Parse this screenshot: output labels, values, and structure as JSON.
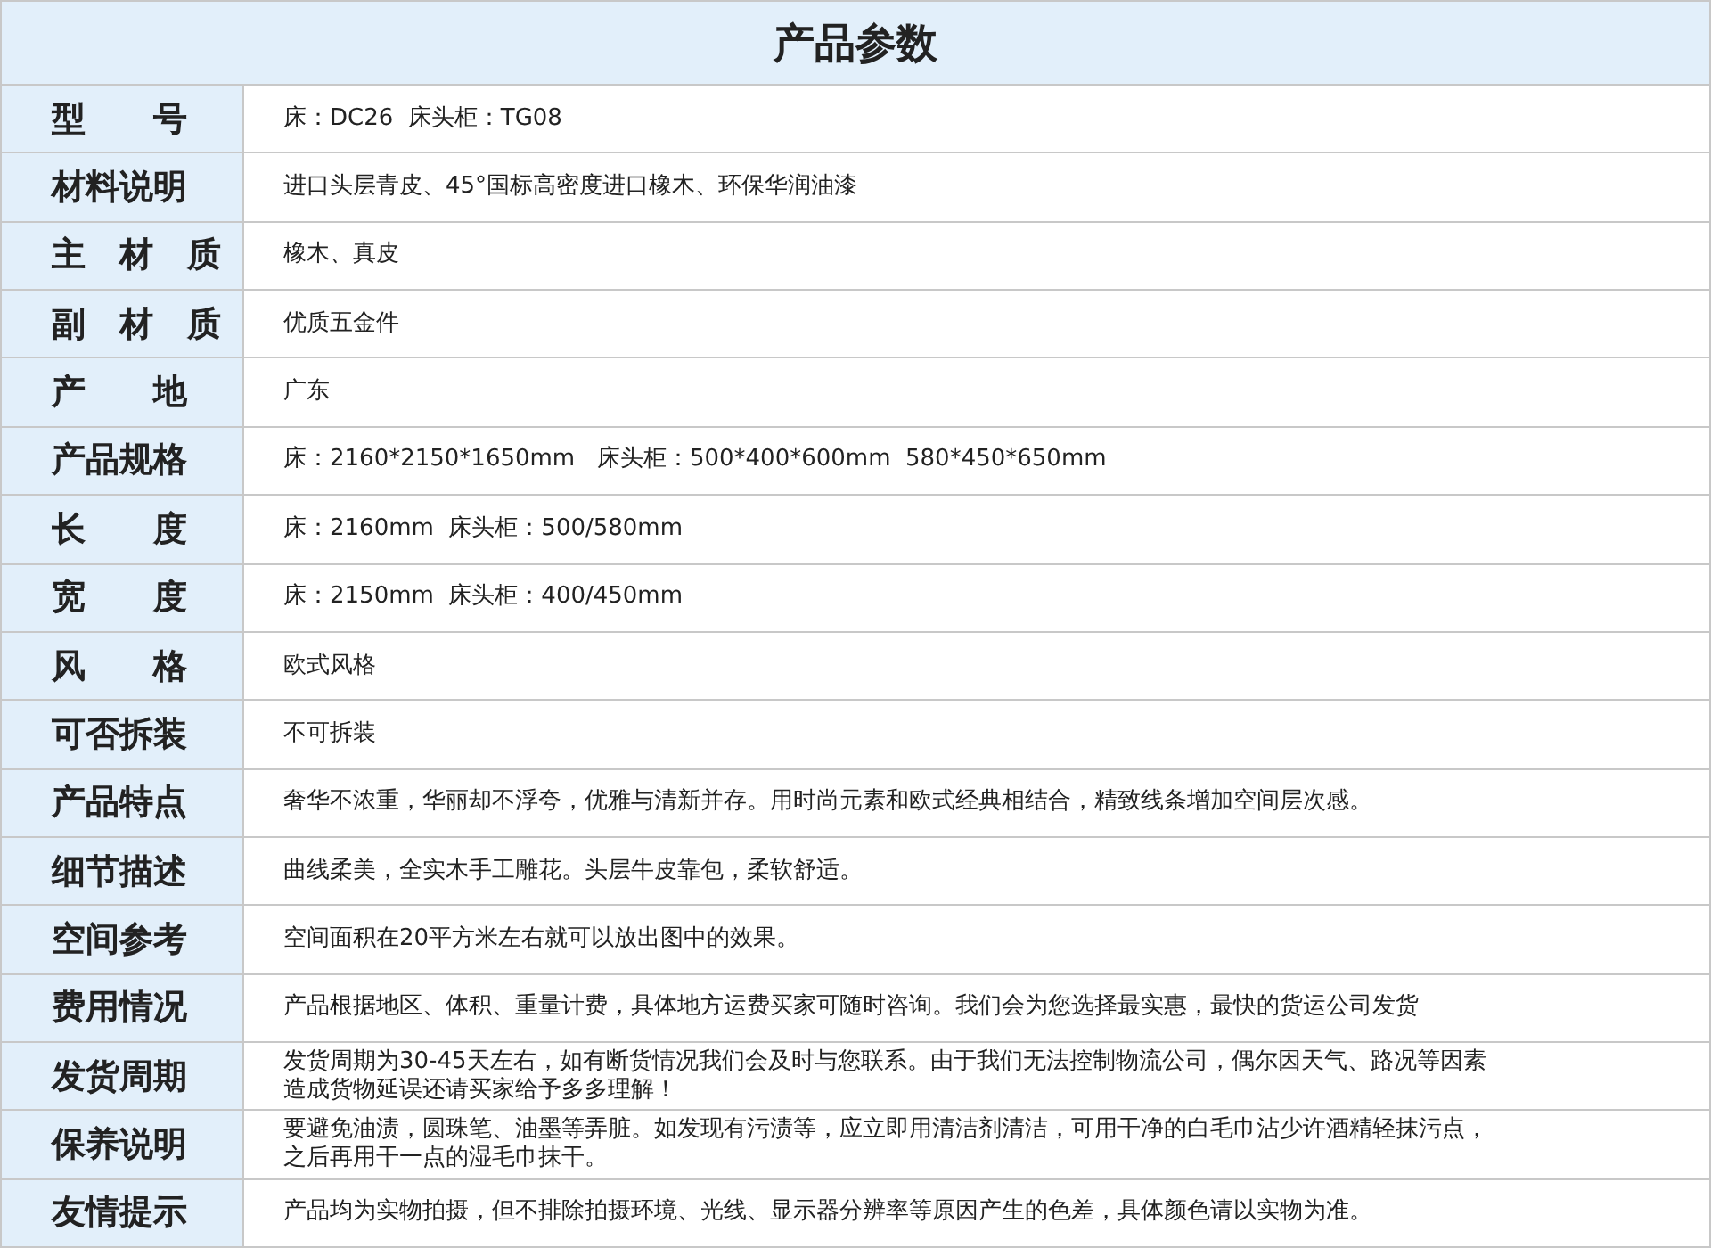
{
  "title": "产品参数",
  "rows": [
    {
      "label": "型　　号",
      "value": [
        "床：DC26  床头柜：TG08"
      ]
    },
    {
      "label": "材料说明",
      "value": [
        "进口头层青皮、45°国标高密度进口橡木、环保华润油漆"
      ]
    },
    {
      "label": "主　材　质",
      "value": [
        "橡木、真皮"
      ]
    },
    {
      "label": "副　材　质",
      "value": [
        "优质五金件"
      ]
    },
    {
      "label": "产　　地",
      "value": [
        "广东"
      ]
    },
    {
      "label": "产品规格",
      "value": [
        "床：2160*2150*1650mm   床头柜：500*400*600mm  580*450*650mm"
      ]
    },
    {
      "label": "长　　度",
      "value": [
        "床：2160mm  床头柜：500/580mm"
      ]
    },
    {
      "label": "宽　　度",
      "value": [
        "床：2150mm  床头柜：400/450mm"
      ]
    },
    {
      "label": "风　　格",
      "value": [
        "欧式风格"
      ]
    },
    {
      "label": "可否拆装",
      "value": [
        "不可拆装"
      ]
    },
    {
      "label": "产品特点",
      "value": [
        "奢华不浓重，华丽却不浮夸，优雅与清新并存。用时尚元素和欧式经典相结合，精致线条增加空间层次感。"
      ]
    },
    {
      "label": "细节描述",
      "value": [
        "曲线柔美，全实木手工雕花。头层牛皮靠包，柔软舒适。"
      ]
    },
    {
      "label": "空间参考",
      "value": [
        "空间面积在20平方米左右就可以放出图中的效果。"
      ]
    },
    {
      "label": "费用情况",
      "value": [
        "产品根据地区、体积、重量计费，具体地方运费买家可随时咨询。我们会为您选择最实惠，最快的货运公司发货"
      ]
    },
    {
      "label": "发货周期",
      "value": [
        "发货周期为30-45天左右，如有断货情况我们会及时与您联系。由于我们无法控制物流公司，偶尔因天气、路况等因素",
        "造成货物延误还请买家给予多多理解！"
      ]
    },
    {
      "label": "保养说明",
      "value": [
        "要避免油渍，圆珠笔、油墨等弄脏。如发现有污渍等，应立即用清洁剂清洁，可用干净的白毛巾沾少许酒精轻抹污点，",
        "之后再用干一点的湿毛巾抹干。"
      ]
    },
    {
      "label": "友情提示",
      "value": [
        "产品均为实物拍摄，但不排除拍摄环境、光线、显示器分辨率等原因产生的色差，具体颜色请以实物为准。"
      ]
    }
  ]
}
